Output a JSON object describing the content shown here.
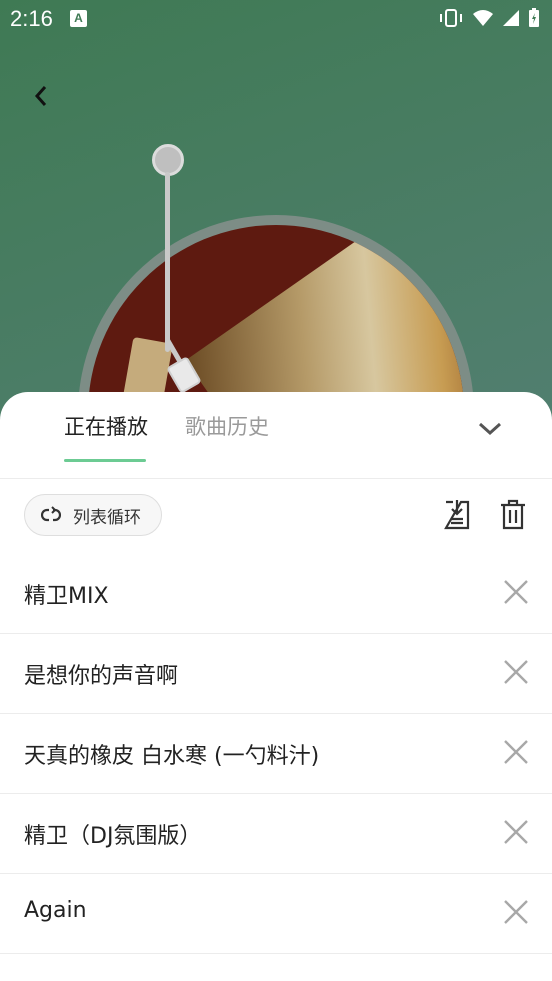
{
  "status_bar": {
    "time": "2:16",
    "notification_badge": "A"
  },
  "player": {
    "back_icon": "chevron-left-icon"
  },
  "tabs": [
    {
      "label": "正在播放"
    },
    {
      "label": "歌曲历史"
    }
  ],
  "controls": {
    "play_mode_label": "列表循环",
    "play_mode_icon": "loop-icon",
    "save_icon": "save-playlist-icon",
    "clear_icon": "trash-icon",
    "collapse_icon": "chevron-down-icon"
  },
  "playlist": [
    {
      "title": "精卫MIX"
    },
    {
      "title": "是想你的声音啊"
    },
    {
      "title": "天真的橡皮 白水寒 (一勺料汁)"
    },
    {
      "title": "精卫（DJ氛围版）"
    },
    {
      "title": "Again"
    }
  ],
  "colors": {
    "accent": "#6ccb93",
    "background_top": "#3f7a54",
    "record_dark": "#5e1a10"
  }
}
